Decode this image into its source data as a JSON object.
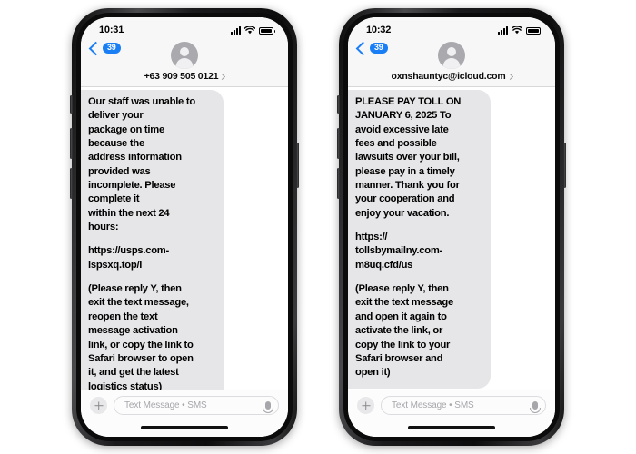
{
  "page": {
    "background_color": "#ffffff",
    "accent_color": "#1a7ef5",
    "bubble_color": "#e6e6e8"
  },
  "phones": [
    {
      "id": "phone-left",
      "status": {
        "time": "10:31",
        "signal_icon": "cellular-bars-icon",
        "wifi_icon": "wifi-icon",
        "battery_icon": "battery-full-icon"
      },
      "nav": {
        "back_icon": "chevron-left-icon",
        "unread_badge": "39",
        "avatar_icon": "contact-avatar-icon",
        "contact_name": "+63 909 505 0121",
        "detail_icon": "chevron-right-icon"
      },
      "message": {
        "paragraph_1": "Our staff was unable to\ndeliver your\npackage on time\nbecause the\naddress information\nprovided was\nincomplete. Please\ncomplete it\nwithin the next 24\nhours:",
        "paragraph_2": "https://usps.com-\nispsxq.top/i",
        "paragraph_3": "(Please reply Y, then\nexit the text message,\nreopen the text\nmessage activation\nlink, or copy the link to\nSafari browser to open\nit, and get the latest\nlogistics status)"
      },
      "composer": {
        "add_icon": "plus-icon",
        "placeholder": "Text Message • SMS",
        "value": "",
        "mic_icon": "microphone-icon"
      },
      "home_indicator": "home-indicator"
    },
    {
      "id": "phone-right",
      "status": {
        "time": "10:32",
        "signal_icon": "cellular-bars-icon",
        "wifi_icon": "wifi-icon",
        "battery_icon": "battery-full-icon"
      },
      "nav": {
        "back_icon": "chevron-left-icon",
        "unread_badge": "39",
        "avatar_icon": "contact-avatar-icon",
        "contact_name": "oxnshauntyc@icloud.com",
        "detail_icon": "chevron-right-icon"
      },
      "message": {
        "paragraph_1": "PLEASE PAY TOLL ON\nJANUARY 6, 2025 To\navoid excessive late\nfees and possible\nlawsuits over your bill,\nplease pay in a timely\nmanner. Thank you for\nyour cooperation and\nenjoy your vacation.",
        "paragraph_2": "https://\ntollsbymailny.com-\nm8uq.cfd/us",
        "paragraph_3": "(Please reply Y, then\nexit the text message\nand open it again to\nactivate the link, or\ncopy the link to your\nSafari browser and\nopen it)"
      },
      "composer": {
        "add_icon": "plus-icon",
        "placeholder": "Text Message • SMS",
        "value": "",
        "mic_icon": "microphone-icon"
      },
      "home_indicator": "home-indicator"
    }
  ]
}
